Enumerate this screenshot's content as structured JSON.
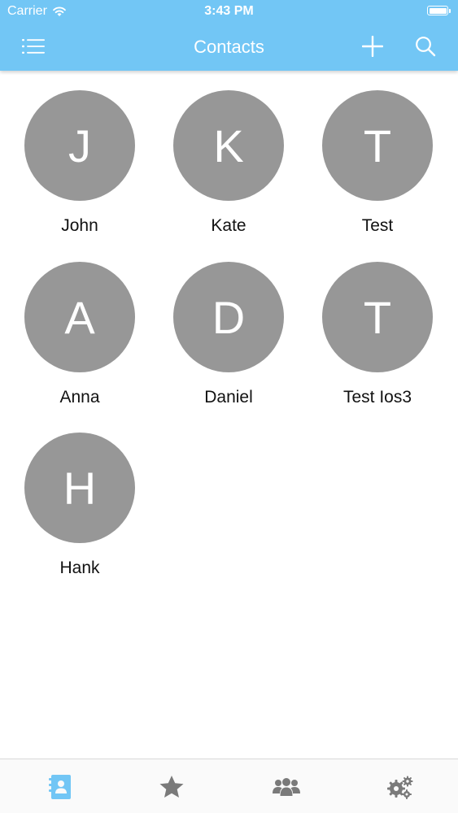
{
  "status_bar": {
    "carrier": "Carrier",
    "time": "3:43 PM",
    "battery_level": 1.0
  },
  "nav": {
    "title": "Contacts",
    "left_icon": "menu-list-icon",
    "right_icons": [
      "plus-icon",
      "search-icon"
    ]
  },
  "contacts": [
    {
      "initial": "J",
      "name": "John"
    },
    {
      "initial": "K",
      "name": "Kate"
    },
    {
      "initial": "T",
      "name": "Test"
    },
    {
      "initial": "A",
      "name": "Anna"
    },
    {
      "initial": "D",
      "name": "Daniel"
    },
    {
      "initial": "T",
      "name": "Test Ios3"
    },
    {
      "initial": "H",
      "name": "Hank"
    }
  ],
  "tabbar": {
    "tabs": [
      {
        "icon": "address-book-icon",
        "selected": true
      },
      {
        "icon": "star-icon",
        "selected": false
      },
      {
        "icon": "users-group-icon",
        "selected": false
      },
      {
        "icon": "gears-icon",
        "selected": false
      }
    ]
  },
  "colors": {
    "accent": "#72c6f5",
    "avatar": "#979797",
    "tab_active": "#72c6f5",
    "tab_inactive": "#7a7a7a"
  }
}
